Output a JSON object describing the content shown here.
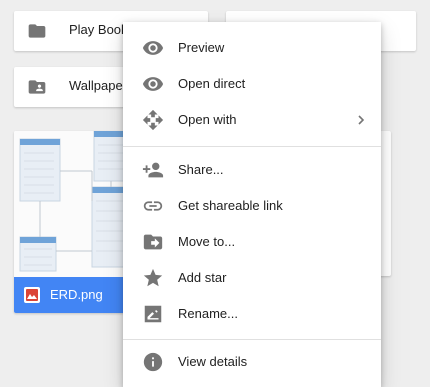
{
  "folders": [
    {
      "label": "Play Books",
      "icon": "folder-icon"
    },
    {
      "label": "Wallpapers",
      "icon": "shared-folder-icon"
    }
  ],
  "file": {
    "name": "ERD.png",
    "type_icon": "image-icon",
    "bar_color": "#4285f4"
  },
  "context_menu": {
    "items": [
      {
        "label": "Preview",
        "icon": "eye-icon"
      },
      {
        "label": "Open direct",
        "icon": "eye-icon"
      },
      {
        "label": "Open with",
        "icon": "move-arrows-icon",
        "submenu": true
      },
      {
        "label": "Share...",
        "icon": "add-person-icon"
      },
      {
        "label": "Get shareable link",
        "icon": "link-icon"
      },
      {
        "label": "Move to...",
        "icon": "folder-move-icon"
      },
      {
        "label": "Add star",
        "icon": "star-icon"
      },
      {
        "label": "Rename...",
        "icon": "edit-icon"
      },
      {
        "label": "View details",
        "icon": "info-icon"
      }
    ]
  },
  "colors": {
    "accent": "#4285f4",
    "icon": "#757575",
    "background": "#eeeeee"
  }
}
